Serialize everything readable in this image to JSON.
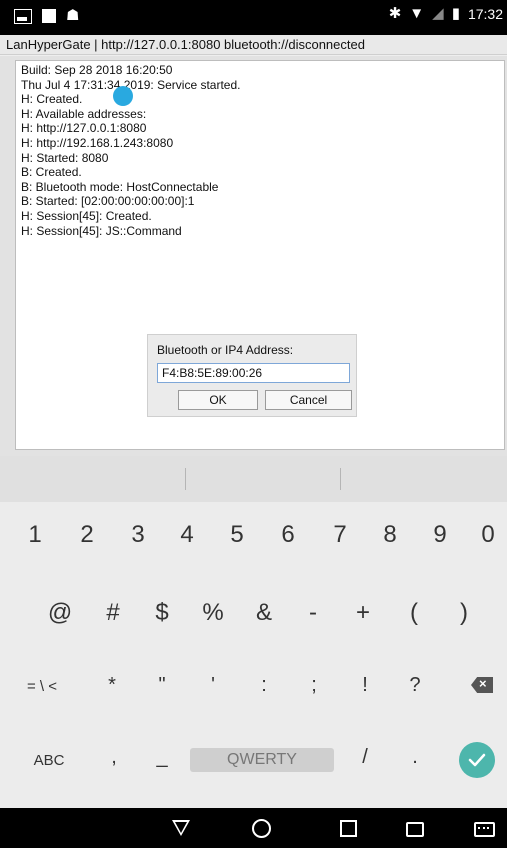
{
  "status": {
    "time": "17:32"
  },
  "title": "LanHyperGate | http://127.0.0.1:8080 bluetooth://disconnected",
  "log": [
    "Build: Sep 28 2018 16:20:50",
    "Thu Jul 4 17:31:34 2019: Service started.",
    "H: Created.",
    "H: Available addresses:",
    "H: http://127.0.0.1:8080",
    "H: http://192.168.1.243:8080",
    "H: Started: 8080",
    "B: Created.",
    "B: Bluetooth mode: HostConnectable",
    "B: Started: [02:00:00:00:00:00]:1",
    "H: Session[45]: Created.",
    "H: Session[45]: JS::Command"
  ],
  "dialog": {
    "label": "Bluetooth or IP4 Address:",
    "value": "F4:B8:5E:89:00:26",
    "ok": "OK",
    "cancel": "Cancel"
  },
  "keyboard": {
    "row1": [
      "1",
      "2",
      "3",
      "4",
      "5",
      "6",
      "7",
      "8",
      "9",
      "0"
    ],
    "row2": [
      "@",
      "#",
      "$",
      "%",
      "&",
      "-",
      "+",
      "(",
      ")"
    ],
    "row3": [
      "= \\ <",
      "*",
      "\"",
      "'",
      ":",
      ";",
      "!",
      "?"
    ],
    "abc": "ABC",
    "comma": ",",
    "underscore": "_",
    "space": "QWERTY",
    "slash": "/",
    "period": ".",
    "backspace_icon": "backspace-icon",
    "enter_icon": "checkmark-icon"
  },
  "colors": {
    "accent": "#4db6ac",
    "touch": "#29a9e0"
  }
}
